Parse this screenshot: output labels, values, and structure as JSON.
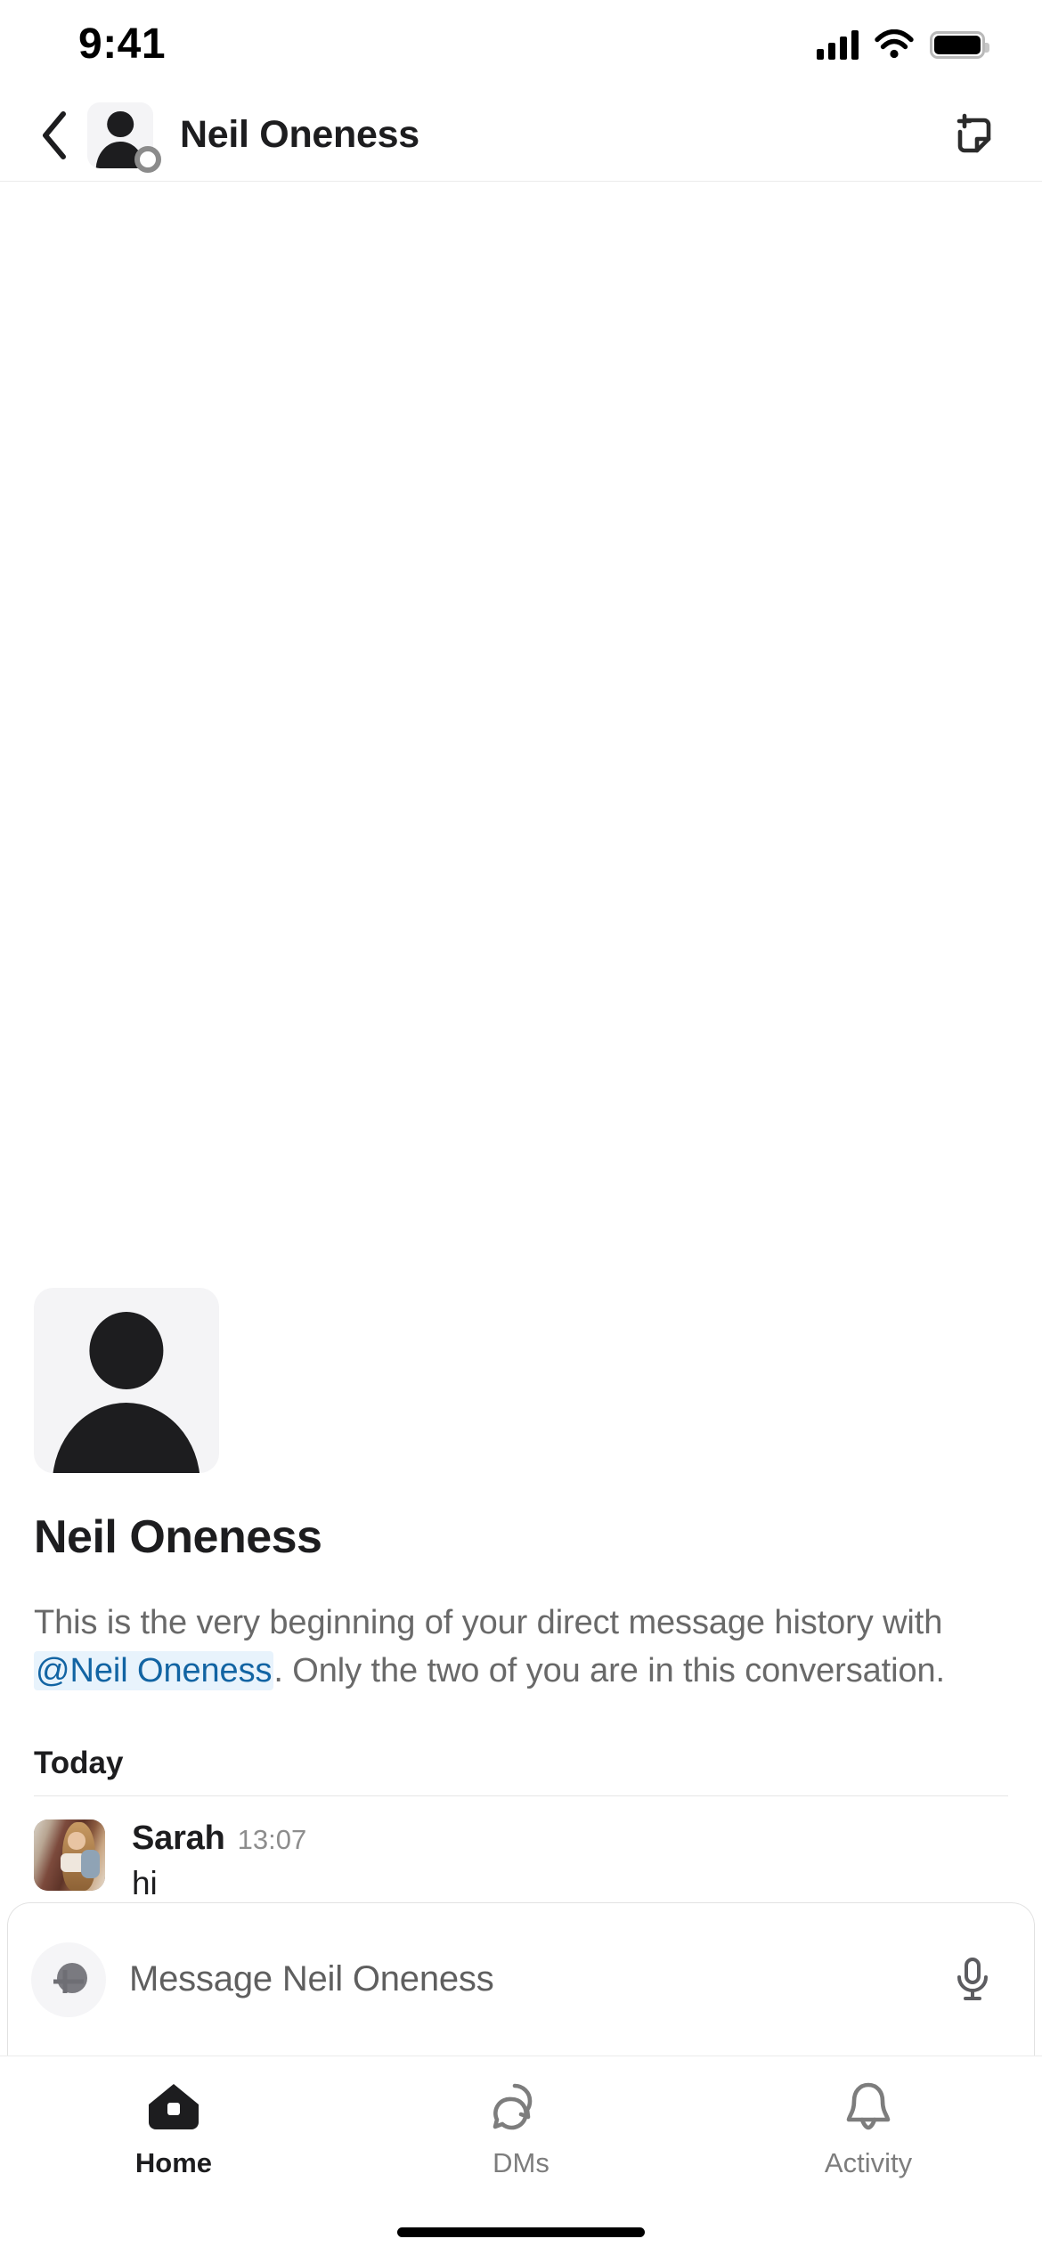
{
  "status_bar": {
    "time": "9:41",
    "cellular_icon": "signal-bars-icon",
    "wifi_icon": "wifi-icon",
    "battery_icon": "battery-full-icon"
  },
  "header": {
    "back_icon": "chevron-left-icon",
    "avatar_icon": "person-avatar-icon",
    "presence": "offline",
    "title": "Neil Oneness",
    "compose_icon": "new-canvas-icon"
  },
  "conversation": {
    "profile": {
      "avatar_icon": "person-avatar-icon",
      "name": "Neil Oneness"
    },
    "intro": {
      "part1": "This is the very beginning of your direct message history with ",
      "mention": "@Neil Oneness",
      "part2": ". Only the two of you are in this conversation."
    },
    "day_divider": "Today",
    "messages": [
      {
        "author": "Sarah",
        "time": "13:07",
        "text": "hi",
        "avatar": "sarah-photo-avatar"
      }
    ]
  },
  "composer": {
    "plus_icon": "plus-icon",
    "placeholder": "Message Neil Oneness",
    "mic_icon": "microphone-icon"
  },
  "tab_bar": {
    "tabs": [
      {
        "label": "Home",
        "icon": "home-icon",
        "active": true
      },
      {
        "label": "DMs",
        "icon": "speech-bubbles-icon",
        "active": false
      },
      {
        "label": "Activity",
        "icon": "bell-icon",
        "active": false
      }
    ]
  },
  "colors": {
    "text_primary": "#1d1d1f",
    "text_secondary": "#696969",
    "mention_text": "#1264a3",
    "mention_bg": "#e8f3fc",
    "divider": "#e6e6e6"
  }
}
